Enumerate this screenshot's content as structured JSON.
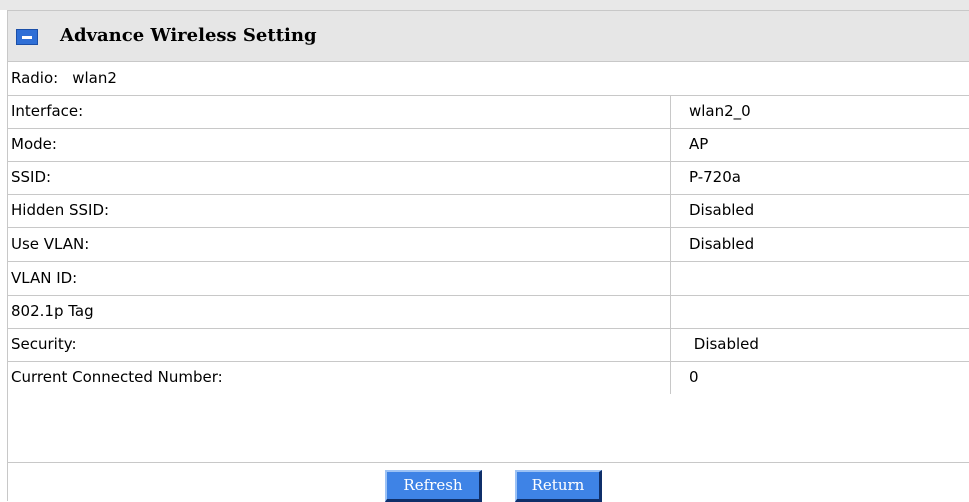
{
  "header": {
    "title": "Advance Wireless Setting"
  },
  "radio": {
    "label": "Radio:",
    "name": "wlan2"
  },
  "rows": [
    {
      "label": "Interface:",
      "value": "wlan2_0"
    },
    {
      "label": "Mode:",
      "value": "AP"
    },
    {
      "label": "SSID:",
      "value": "P-720a"
    },
    {
      "label": "Hidden SSID:",
      "value": "Disabled"
    },
    {
      "label": "Use VLAN:",
      "value": "Disabled"
    },
    {
      "label": "VLAN ID:",
      "value": ""
    },
    {
      "label": "802.1p Tag",
      "value": ""
    },
    {
      "label": "Security:",
      "value": " Disabled"
    },
    {
      "label": "Current Connected Number:",
      "value": "0"
    }
  ],
  "buttons": {
    "refresh_label": "Refresh",
    "return_label": "Return"
  },
  "colors": {
    "header_background": "#e6e6e6",
    "button_blue": "#3e83e6",
    "icon_blue": "#2f6fd6",
    "grid_line": "#c8c8c8"
  }
}
